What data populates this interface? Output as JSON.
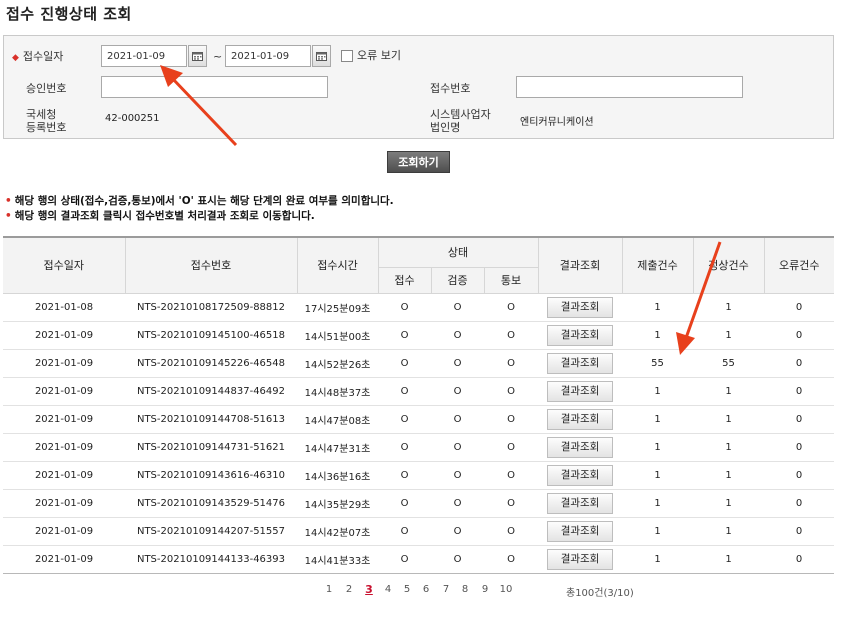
{
  "page": {
    "title": "접수 진행상태 조회"
  },
  "search": {
    "receipt_date_label": "접수일자",
    "date_from": "2021-01-09",
    "date_to": "2021-01-09",
    "tilde": "~",
    "error_view_label": "오류 보기",
    "error_view_checked": false,
    "approval_no_label": "승인번호",
    "approval_no_value": "",
    "receipt_no_label": "접수번호",
    "receipt_no_value": "",
    "nts_reg_label_1": "국세청",
    "nts_reg_label_2": "등록번호",
    "nts_reg_value": "42-000251",
    "system_corp_label_1": "시스템사업자",
    "system_corp_label_2": "법인명",
    "system_corp_value": "엔티커뮤니케이션",
    "search_button": "조회하기"
  },
  "notes": [
    "해당 행의 상태(접수,검증,통보)에서 'O' 표시는 해당 단계의 완료 여부를 의미합니다.",
    "해당 행의 결과조회 클릭시 접수번호별 처리결과 조회로 이동합니다."
  ],
  "table": {
    "headers": {
      "date": "접수일자",
      "receipt_no": "접수번호",
      "time": "접수시간",
      "status": "상태",
      "status_receipt": "접수",
      "status_verify": "검증",
      "status_notify": "통보",
      "result": "결과조회",
      "submitted": "제출건수",
      "normal": "정상건수",
      "error": "오류건수"
    },
    "result_button_label": "결과조회",
    "rows": [
      {
        "date": "2021-01-08",
        "receipt_no": "NTS-20210108172509-88812",
        "time": "17시25분09초",
        "s1": "O",
        "s2": "O",
        "s3": "O",
        "submitted": "1",
        "normal": "1",
        "error": "0"
      },
      {
        "date": "2021-01-09",
        "receipt_no": "NTS-20210109145100-46518",
        "time": "14시51분00초",
        "s1": "O",
        "s2": "O",
        "s3": "O",
        "submitted": "1",
        "normal": "1",
        "error": "0"
      },
      {
        "date": "2021-01-09",
        "receipt_no": "NTS-20210109145226-46548",
        "time": "14시52분26초",
        "s1": "O",
        "s2": "O",
        "s3": "O",
        "submitted": "55",
        "normal": "55",
        "error": "0"
      },
      {
        "date": "2021-01-09",
        "receipt_no": "NTS-20210109144837-46492",
        "time": "14시48분37초",
        "s1": "O",
        "s2": "O",
        "s3": "O",
        "submitted": "1",
        "normal": "1",
        "error": "0"
      },
      {
        "date": "2021-01-09",
        "receipt_no": "NTS-20210109144708-51613",
        "time": "14시47분08초",
        "s1": "O",
        "s2": "O",
        "s3": "O",
        "submitted": "1",
        "normal": "1",
        "error": "0"
      },
      {
        "date": "2021-01-09",
        "receipt_no": "NTS-20210109144731-51621",
        "time": "14시47분31초",
        "s1": "O",
        "s2": "O",
        "s3": "O",
        "submitted": "1",
        "normal": "1",
        "error": "0"
      },
      {
        "date": "2021-01-09",
        "receipt_no": "NTS-20210109143616-46310",
        "time": "14시36분16초",
        "s1": "O",
        "s2": "O",
        "s3": "O",
        "submitted": "1",
        "normal": "1",
        "error": "0"
      },
      {
        "date": "2021-01-09",
        "receipt_no": "NTS-20210109143529-51476",
        "time": "14시35분29초",
        "s1": "O",
        "s2": "O",
        "s3": "O",
        "submitted": "1",
        "normal": "1",
        "error": "0"
      },
      {
        "date": "2021-01-09",
        "receipt_no": "NTS-20210109144207-51557",
        "time": "14시42분07초",
        "s1": "O",
        "s2": "O",
        "s3": "O",
        "submitted": "1",
        "normal": "1",
        "error": "0"
      },
      {
        "date": "2021-01-09",
        "receipt_no": "NTS-20210109144133-46393",
        "time": "14시41분33초",
        "s1": "O",
        "s2": "O",
        "s3": "O",
        "submitted": "1",
        "normal": "1",
        "error": "0"
      }
    ]
  },
  "pagination": {
    "pages": [
      "1",
      "2",
      "3",
      "4",
      "5",
      "6",
      "7",
      "8",
      "9",
      "10"
    ],
    "current": "3",
    "total_text": "총100건(3/10)"
  },
  "colors": {
    "annotation_arrow": "#e8401c",
    "required_mark": "#d9312a",
    "active_page": "#c8102e"
  }
}
